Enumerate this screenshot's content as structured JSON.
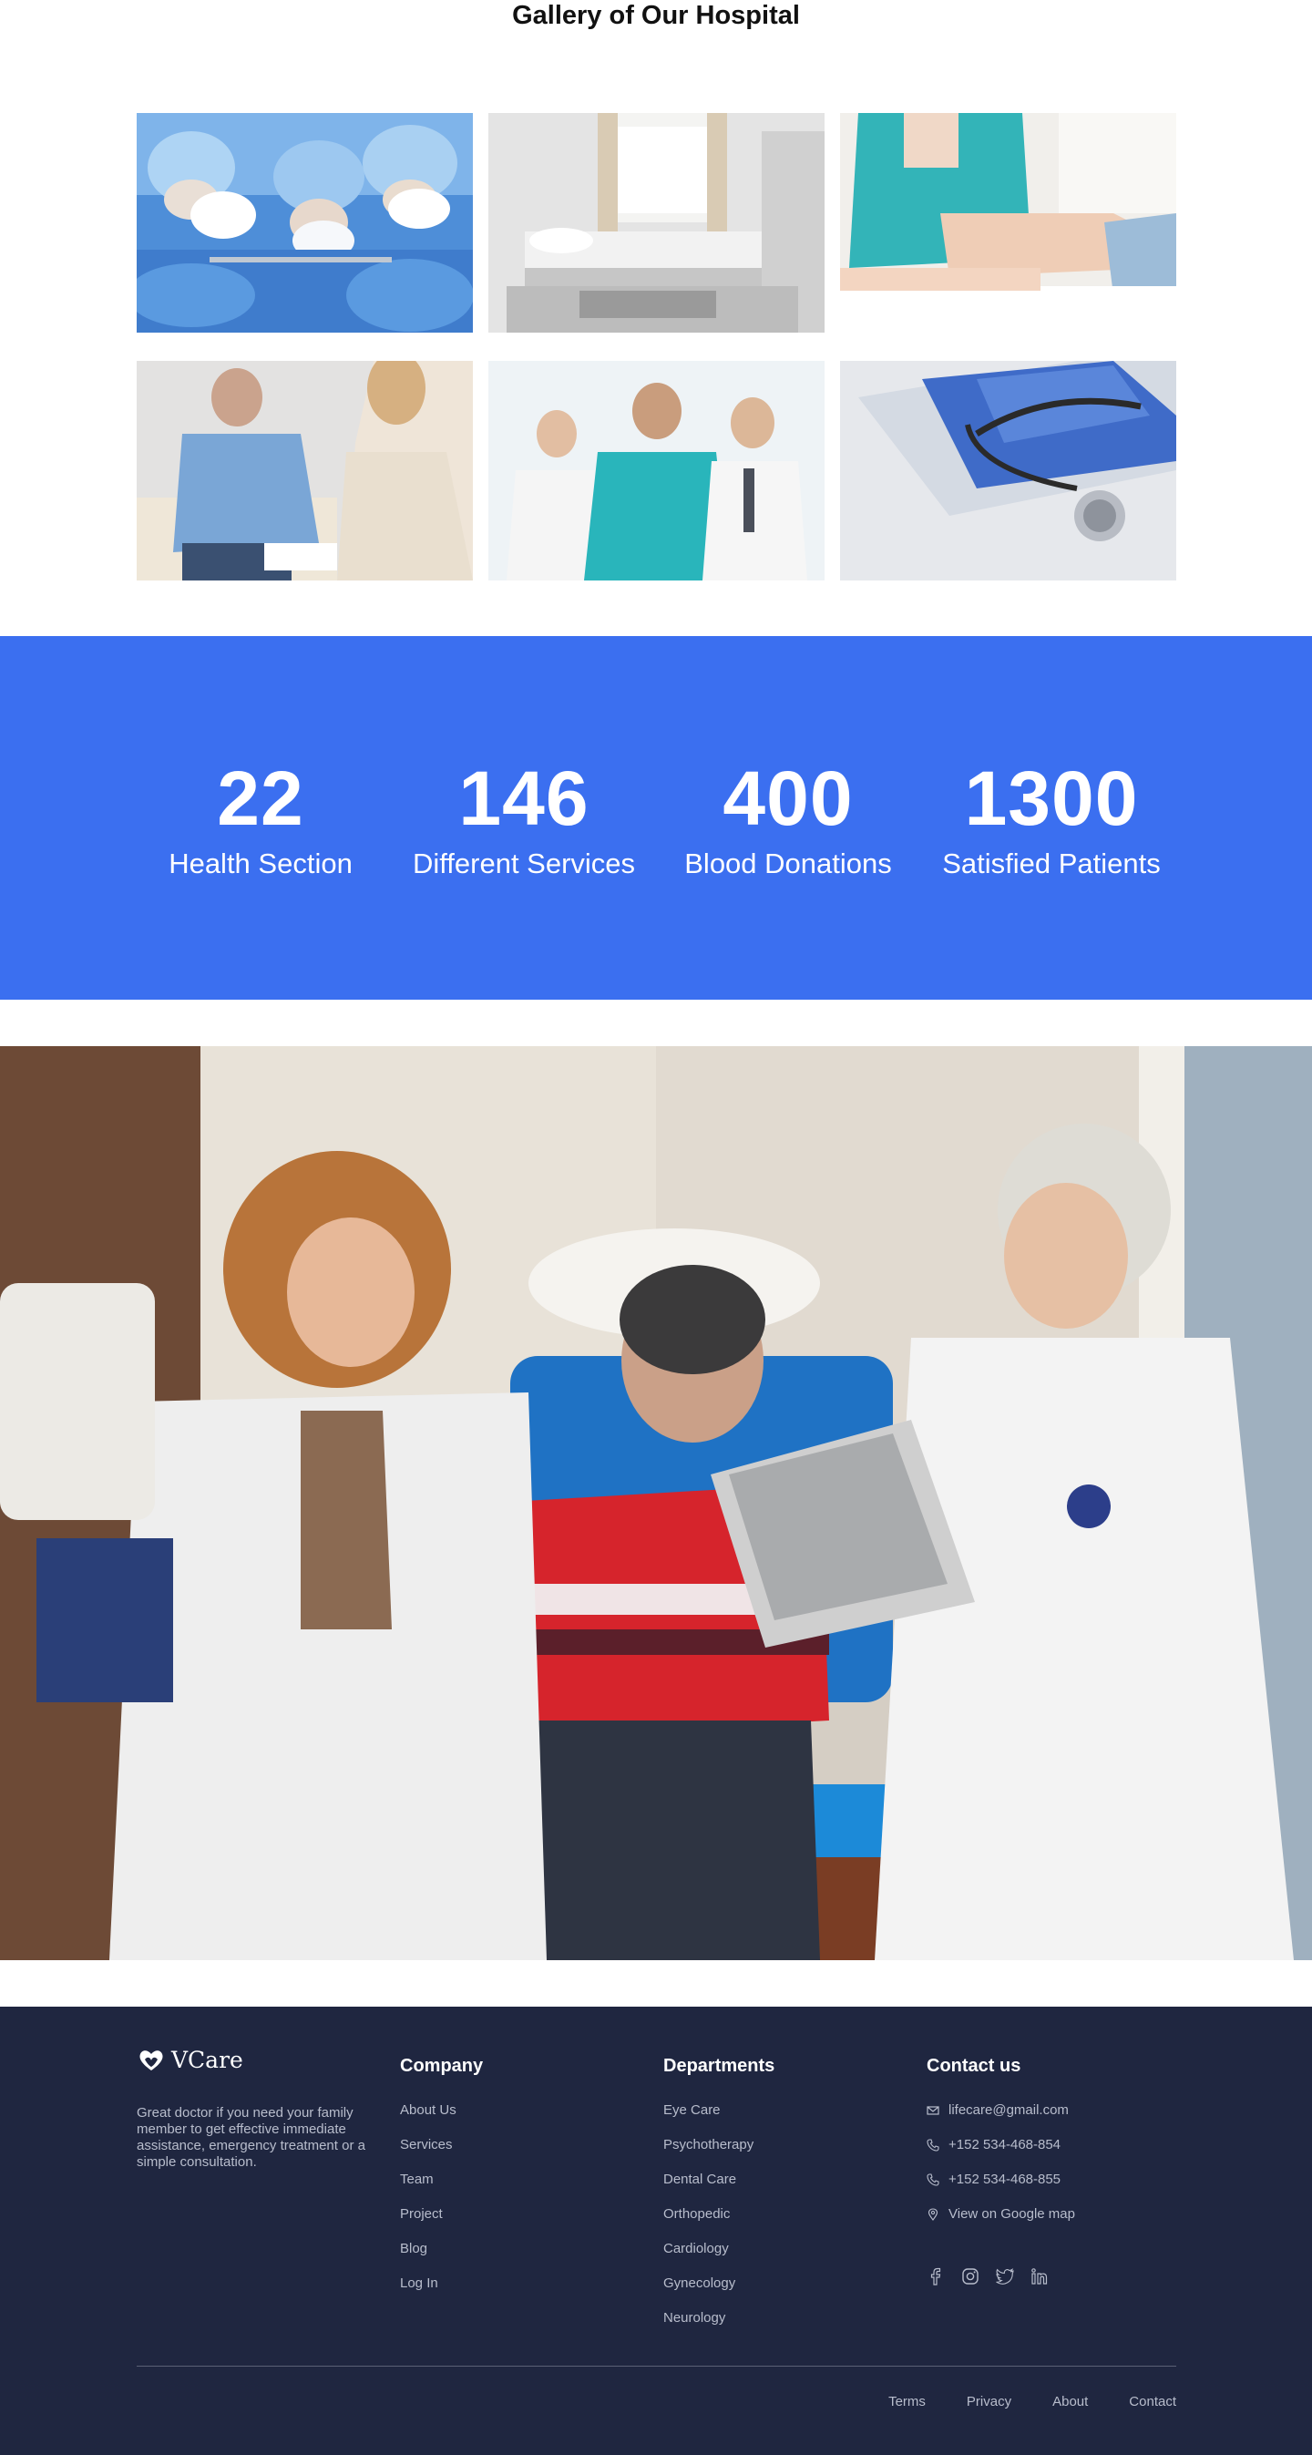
{
  "gallery": {
    "title": "Gallery of Our Hospital",
    "photos": [
      {
        "subject": "surgeons in operating room"
      },
      {
        "subject": "hospital ward bed"
      },
      {
        "subject": "nurse examining leg"
      },
      {
        "subject": "patient consultation"
      },
      {
        "subject": "medical team"
      },
      {
        "subject": "stethoscope on tablet"
      }
    ]
  },
  "stats": [
    {
      "number": "22",
      "label": "Health Section"
    },
    {
      "number": "146",
      "label": "Different Services"
    },
    {
      "number": "400",
      "label": "Blood Donations"
    },
    {
      "number": "1300",
      "label": "Satisfied Patients"
    }
  ],
  "hero": {
    "subject": "doctors examining a child patient"
  },
  "footer": {
    "brand": {
      "name": "VCare",
      "icon": "heart-hands-icon"
    },
    "tagline": "Great doctor if you need your family member to get effective immediate assistance, emergency treatment or a simple consultation.",
    "company": {
      "heading": "Company",
      "links": [
        "About Us",
        "Services",
        "Team",
        "Project",
        "Blog",
        "Log In"
      ]
    },
    "departments": {
      "heading": "Departments",
      "links": [
        "Eye Care",
        "Psychotherapy",
        "Dental Care",
        "Orthopedic",
        "Cardiology",
        "Gynecology",
        "Neurology"
      ]
    },
    "contact": {
      "heading": "Contact us",
      "items": [
        {
          "icon": "envelope-icon",
          "text": "lifecare@gmail.com"
        },
        {
          "icon": "phone-icon",
          "text": "+152 534-468-854"
        },
        {
          "icon": "phone-icon",
          "text": "+152 534-468-855"
        },
        {
          "icon": "map-pin-icon",
          "text": "View on Google map"
        }
      ]
    },
    "socials": [
      "facebook-icon",
      "instagram-icon",
      "twitter-icon",
      "linkedin-icon"
    ],
    "bottom_links": [
      "Terms",
      "Privacy",
      "About",
      "Contact"
    ]
  },
  "colors": {
    "accent": "#3b6ff0",
    "footer_bg": "#1f2640",
    "footer_text": "#b8bdcc"
  }
}
